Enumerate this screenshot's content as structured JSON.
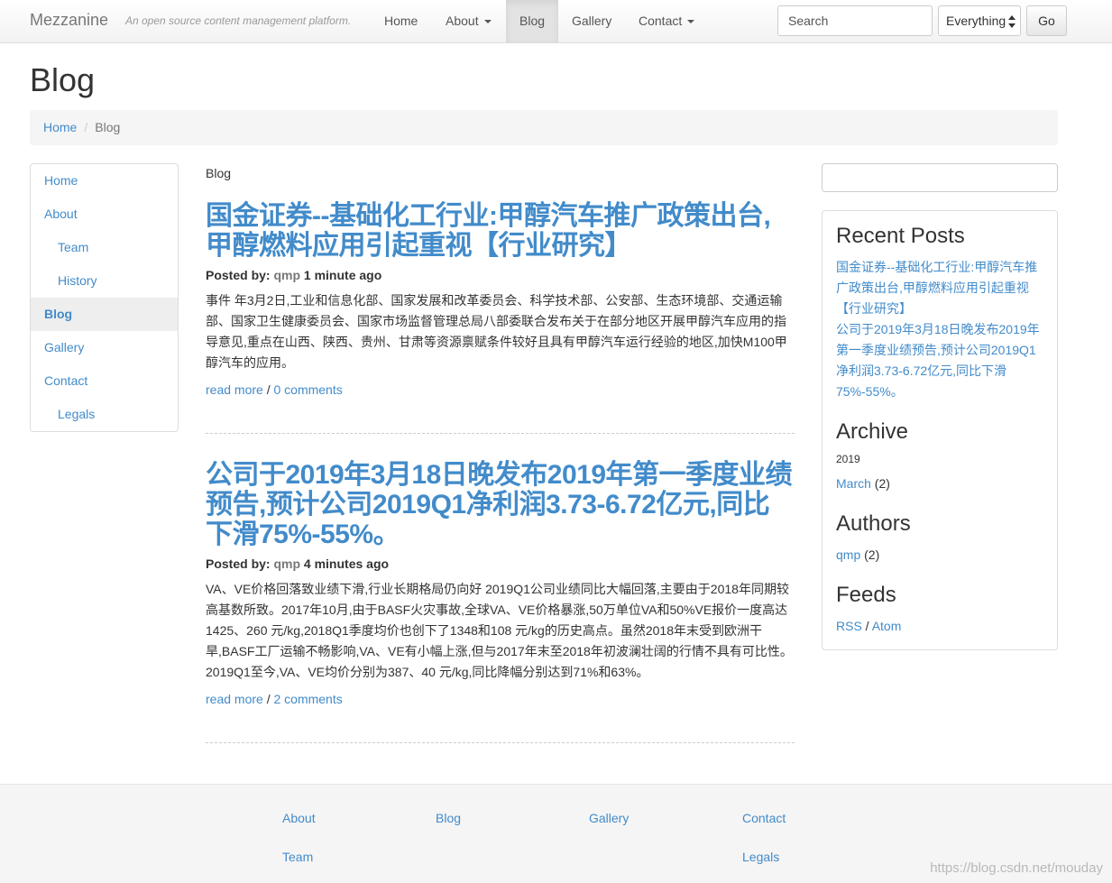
{
  "navbar": {
    "brand": "Mezzanine",
    "tagline": "An open source content management platform.",
    "items": [
      {
        "label": "Home"
      },
      {
        "label": "About"
      },
      {
        "label": "Blog"
      },
      {
        "label": "Gallery"
      },
      {
        "label": "Contact"
      }
    ],
    "search_placeholder": "Search",
    "scope_value": "Everything",
    "go_label": "Go"
  },
  "page": {
    "title": "Blog",
    "breadcrumb": [
      "Home",
      "Blog"
    ]
  },
  "left_nav": {
    "items": [
      {
        "label": "Home"
      },
      {
        "label": "About"
      },
      {
        "label": "Team"
      },
      {
        "label": "History"
      },
      {
        "label": "Blog"
      },
      {
        "label": "Gallery"
      },
      {
        "label": "Contact"
      },
      {
        "label": "Legals"
      }
    ]
  },
  "main": {
    "heading": "Blog",
    "posts": [
      {
        "title": "国金证券--基础化工行业:甲醇汽车推广政策出台,甲醇燃料应用引起重视【行业研究】",
        "posted_by_label": "Posted by:",
        "author": "qmp",
        "time": "1 minute ago",
        "body": "事件 年3月2日,工业和信息化部、国家发展和改革委员会、科学技术部、公安部、生态环境部、交通运输部、国家卫生健康委员会、国家市场监督管理总局八部委联合发布关于在部分地区开展甲醇汽车应用的指导意见,重点在山西、陕西、贵州、甘肃等资源禀赋条件较好且具有甲醇汽车运行经验的地区,加快M100甲醇汽车的应用。",
        "read_more": "read more",
        "sep": " / ",
        "comments": "0 comments"
      },
      {
        "title": "公司于2019年3月18日晚发布2019年第一季度业绩预告,预计公司2019Q1净利润3.73-6.72亿元,同比下滑75%-55%。",
        "posted_by_label": "Posted by:",
        "author": "qmp",
        "time": "4 minutes ago",
        "body": "VA、VE价格回落致业绩下滑,行业长期格局仍向好 2019Q1公司业绩同比大幅回落,主要由于2018年同期较高基数所致。2017年10月,由于BASF火灾事故,全球VA、VE价格暴涨,50万单位VA和50%VE报价一度高达1425、260 元/kg,2018Q1季度均价也创下了1348和108 元/kg的历史高点。虽然2018年末受到欧洲干旱,BASF工厂运输不畅影响,VA、VE有小幅上涨,但与2017年末至2018年初波澜壮阔的行情不具有可比性。2019Q1至今,VA、VE均价分别为387、40 元/kg,同比降幅分别达到71%和63%。",
        "read_more": "read more",
        "sep": " / ",
        "comments": "2 comments"
      }
    ]
  },
  "sidebar": {
    "recent_posts_title": "Recent Posts",
    "recent_posts": [
      "国金证券--基础化工行业:甲醇汽车推广政策出台,甲醇燃料应用引起重视【行业研究】",
      "公司于2019年3月18日晚发布2019年第一季度业绩预告,预计公司2019Q1净利润3.73-6.72亿元,同比下滑75%-55%。"
    ],
    "archive_title": "Archive",
    "archive_year": "2019",
    "archive_month": "March",
    "archive_count": "(2)",
    "authors_title": "Authors",
    "author_name": "qmp",
    "author_count": "(2)",
    "feeds_title": "Feeds",
    "feed_rss": "RSS",
    "feed_sep": " / ",
    "feed_atom": "Atom"
  },
  "footer": {
    "links": [
      "About",
      "Blog",
      "Gallery",
      "Contact",
      "Team",
      "Legals"
    ],
    "watermark": "https://blog.csdn.net/mouday"
  },
  "colors": {
    "link": "#428bca",
    "text": "#333333",
    "muted": "#777777"
  }
}
